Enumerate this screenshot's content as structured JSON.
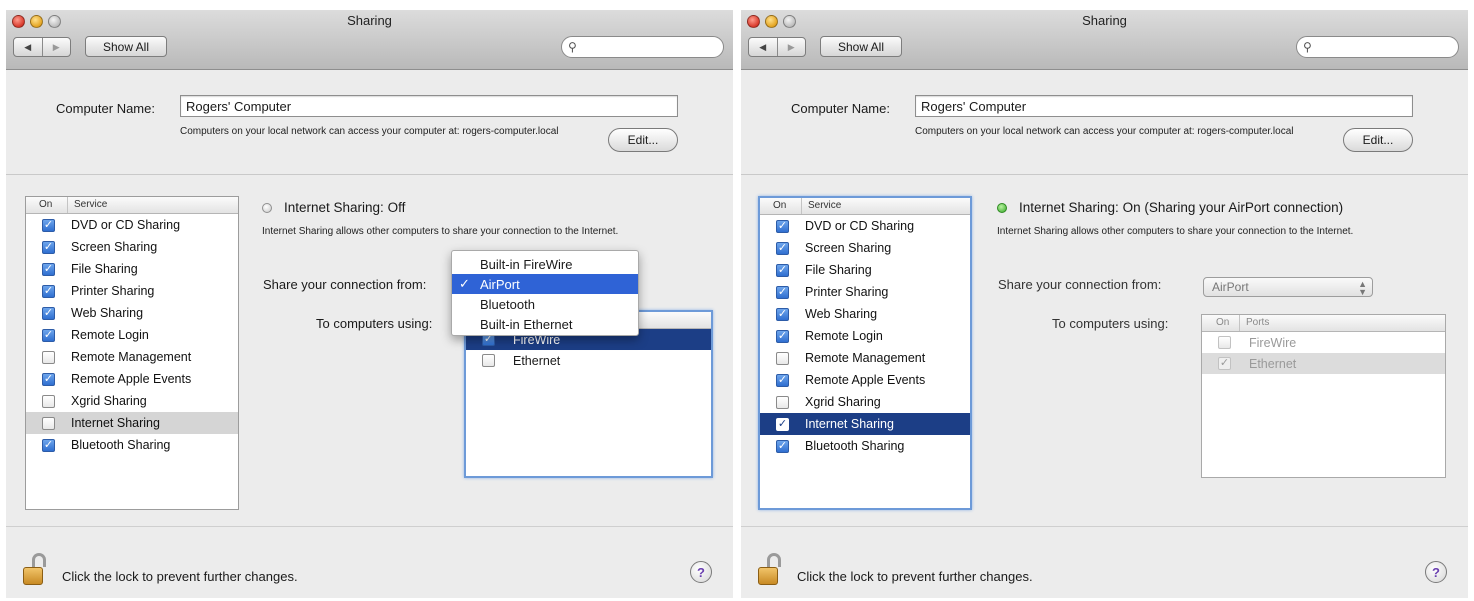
{
  "left": {
    "title": "Sharing",
    "show_all": "Show All",
    "computer_name_label": "Computer Name:",
    "computer_name": "Rogers' Computer",
    "computer_name_desc": "Computers on your local network can access your computer at: rogers-computer.local",
    "edit_label": "Edit...",
    "service_col_on": "On",
    "service_col_service": "Service",
    "services": [
      {
        "label": "DVD or CD Sharing",
        "on": true
      },
      {
        "label": "Screen Sharing",
        "on": true
      },
      {
        "label": "File Sharing",
        "on": true
      },
      {
        "label": "Printer Sharing",
        "on": true
      },
      {
        "label": "Web Sharing",
        "on": true
      },
      {
        "label": "Remote Login",
        "on": true
      },
      {
        "label": "Remote Management",
        "on": false
      },
      {
        "label": "Remote Apple Events",
        "on": true
      },
      {
        "label": "Xgrid Sharing",
        "on": false
      },
      {
        "label": "Internet Sharing",
        "on": false
      },
      {
        "label": "Bluetooth Sharing",
        "on": true
      }
    ],
    "selected_service": "Internet Sharing",
    "status_text": "Internet Sharing: Off",
    "description": "Internet Sharing allows other computers to share your connection to the Internet.",
    "share_from_label": "Share your connection from:",
    "to_computers_label": "To computers using:",
    "menu_options": [
      "Built-in FireWire",
      "AirPort",
      "Bluetooth",
      "Built-in Ethernet"
    ],
    "menu_selected": "AirPort",
    "check_mark": "✓",
    "ports": [
      {
        "label": "FireWire",
        "on": true
      },
      {
        "label": "Ethernet",
        "on": false
      }
    ],
    "lock_text": "Click the lock to prevent further changes.",
    "help_label": "?"
  },
  "right": {
    "title": "Sharing",
    "show_all": "Show All",
    "computer_name_label": "Computer Name:",
    "computer_name": "Rogers' Computer",
    "computer_name_desc": "Computers on your local network can access your computer at: rogers-computer.local",
    "edit_label": "Edit...",
    "service_col_on": "On",
    "service_col_service": "Service",
    "services": [
      {
        "label": "DVD or CD Sharing",
        "on": true
      },
      {
        "label": "Screen Sharing",
        "on": true
      },
      {
        "label": "File Sharing",
        "on": true
      },
      {
        "label": "Printer Sharing",
        "on": true
      },
      {
        "label": "Web Sharing",
        "on": true
      },
      {
        "label": "Remote Login",
        "on": true
      },
      {
        "label": "Remote Management",
        "on": false
      },
      {
        "label": "Remote Apple Events",
        "on": true
      },
      {
        "label": "Xgrid Sharing",
        "on": false
      },
      {
        "label": "Internet Sharing",
        "on": true
      },
      {
        "label": "Bluetooth Sharing",
        "on": true
      }
    ],
    "selected_service": "Internet Sharing",
    "status_text": "Internet Sharing: On (Sharing your AirPort connection)",
    "description": "Internet Sharing allows other computers to share your connection to the Internet.",
    "share_from_label": "Share your connection from:",
    "share_from_value": "AirPort",
    "to_computers_label": "To computers using:",
    "ports_col_on": "On",
    "ports_col_ports": "Ports",
    "ports": [
      {
        "label": "FireWire",
        "on": false
      },
      {
        "label": "Ethernet",
        "on": true
      }
    ],
    "lock_text": "Click the lock to prevent further changes.",
    "help_label": "?"
  },
  "colors": {
    "selection_blue": "#1c3e86",
    "menu_highlight": "#2f63d6",
    "status_on_green": "#37a829",
    "focus_ring": "#6d9ad8"
  }
}
